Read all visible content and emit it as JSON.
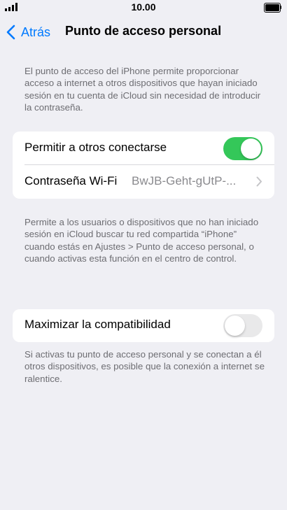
{
  "status_bar": {
    "time": "10.00"
  },
  "nav": {
    "back_label": "Atrás",
    "title": "Punto de acceso personal"
  },
  "intro_text": "El punto de acceso del iPhone permite proporcionar acceso a internet a otros dispositivos que hayan iniciado sesión en tu cuenta de iCloud sin necesidad de introducir la contraseña.",
  "settings_group_1": {
    "allow_others": {
      "label": "Permitir a otros conectarse",
      "state": "on"
    },
    "wifi_password": {
      "label": "Contraseña Wi-Fi",
      "value": "BwJB-Geht-gUtP-..."
    }
  },
  "allow_footnote": "Permite a los usuarios o dispositivos que no han iniciado sesión en iCloud buscar tu red compartida “iPhone” cuando estás en Ajustes > Punto de acceso personal, o cuando activas esta función en el centro de control.",
  "settings_group_2": {
    "maximize_compat": {
      "label": "Maximizar la compatibilidad",
      "state": "off"
    }
  },
  "compat_footnote": "Si activas tu punto de acceso personal y se conectan a él otros dispositivos, es posible que la conexión a internet se ralentice.",
  "colors": {
    "accent": "#007aff",
    "toggle_on": "#34c759",
    "background": "#efeff4"
  },
  "icons": [
    "signal-icon",
    "battery-icon",
    "back-chevron-icon",
    "chevron-right-icon"
  ]
}
